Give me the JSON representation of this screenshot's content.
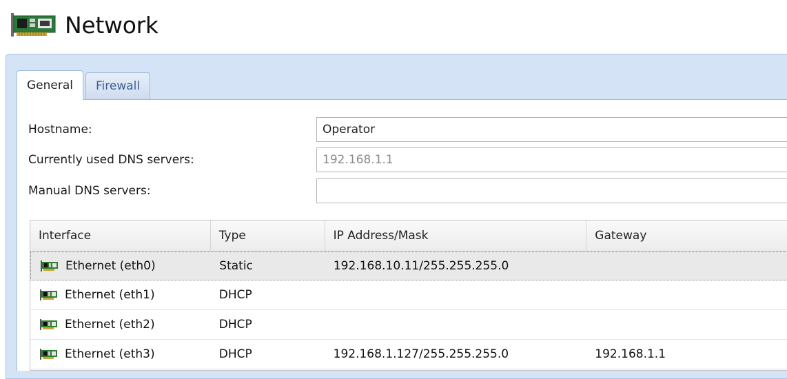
{
  "header": {
    "title": "Network",
    "icon": "network-card-icon"
  },
  "tabs": [
    {
      "label": "General",
      "active": true
    },
    {
      "label": "Firewall",
      "active": false
    }
  ],
  "form": {
    "hostname": {
      "label": "Hostname:",
      "value": "Operator"
    },
    "current_dns": {
      "label": "Currently used DNS servers:",
      "value": "192.168.1.1"
    },
    "manual_dns": {
      "label": "Manual DNS servers:",
      "value": ""
    }
  },
  "grid": {
    "columns": [
      "Interface",
      "Type",
      "IP Address/Mask",
      "Gateway"
    ],
    "rows": [
      {
        "interface": "Ethernet (eth0)",
        "type": "Static",
        "ip": "192.168.10.11/255.255.255.0",
        "gateway": "",
        "selected": true,
        "icon": "ethernet-icon"
      },
      {
        "interface": "Ethernet (eth1)",
        "type": "DHCP",
        "ip": "",
        "gateway": "",
        "selected": false,
        "icon": "ethernet-icon"
      },
      {
        "interface": "Ethernet (eth2)",
        "type": "DHCP",
        "ip": "",
        "gateway": "",
        "selected": false,
        "icon": "ethernet-icon"
      },
      {
        "interface": "Ethernet (eth3)",
        "type": "DHCP",
        "ip": "192.168.1.127/255.255.255.0",
        "gateway": "192.168.1.1",
        "selected": false,
        "icon": "ethernet-icon"
      }
    ]
  },
  "colors": {
    "panel_bg": "#d5e3f6",
    "tab_inactive_text": "#3c5e93",
    "icon_green": "#2f7d32"
  }
}
